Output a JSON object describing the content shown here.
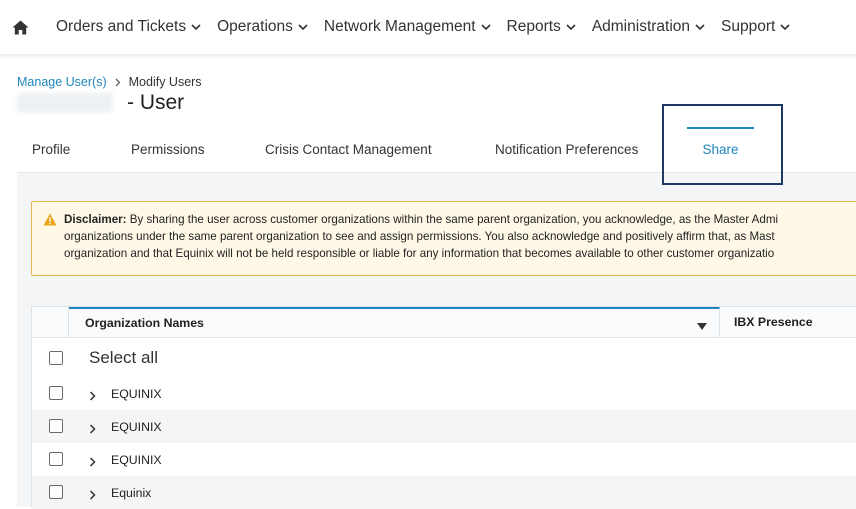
{
  "nav": {
    "items": [
      {
        "label": "Orders and Tickets"
      },
      {
        "label": "Operations"
      },
      {
        "label": "Network Management"
      },
      {
        "label": "Reports"
      },
      {
        "label": "Administration"
      },
      {
        "label": "Support"
      }
    ]
  },
  "breadcrumb": {
    "parent": "Manage User(s)",
    "current": "Modify Users"
  },
  "page": {
    "title": "- User"
  },
  "tabs": [
    {
      "label": "Profile"
    },
    {
      "label": "Permissions"
    },
    {
      "label": "Crisis Contact Management"
    },
    {
      "label": "Notification Preferences"
    },
    {
      "label": "Share",
      "active": true
    }
  ],
  "disclaimer": {
    "label": "Disclaimer:",
    "line1": "By sharing the user across customer organizations within the same parent organization, you acknowledge, as the Master Admi",
    "line2": "organizations under the same parent organization to see and assign permissions. You also acknowledge and positively affirm that, as Mast",
    "line3": "organization and that Equinix will not be held responsible or liable for any information that becomes available to other customer organizatio"
  },
  "table": {
    "columns": {
      "org": "Organization Names",
      "ibx": "IBX Presence"
    },
    "select_all": "Select all",
    "rows": [
      {
        "name": "EQUINIX"
      },
      {
        "name": "EQUINIX"
      },
      {
        "name": "EQUINIX"
      },
      {
        "name": "Equinix"
      }
    ]
  },
  "colors": {
    "accent": "#1f86bf",
    "highlight_border": "#1c3a63",
    "warning_bg": "#fff8e7",
    "warning_border": "#e7b454",
    "warning_icon": "#e8a317"
  },
  "icons": {
    "home": "home-icon",
    "nav_chevron": "chevron-down-icon",
    "breadcrumb_sep": "chevron-right-icon",
    "warning": "warning-icon",
    "sort": "caret-down-icon",
    "expand": "chevron-right-icon"
  }
}
